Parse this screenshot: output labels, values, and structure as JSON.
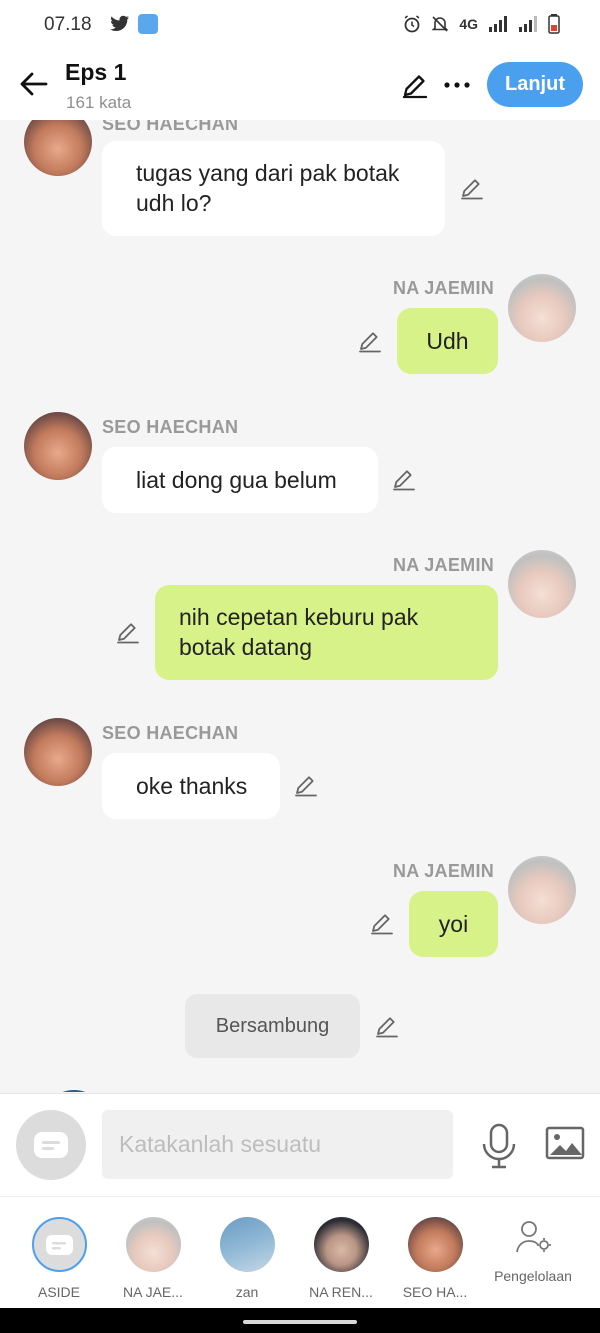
{
  "status_bar": {
    "time": "07.18",
    "network": "4G",
    "icons": [
      "twitter-icon",
      "novel-app-icon",
      "alarm-icon",
      "bell-off-icon",
      "signal-icon",
      "signal-icon",
      "battery-icon"
    ]
  },
  "header": {
    "title": "Eps 1",
    "subtitle": "161 kata",
    "next_label": "Lanjut",
    "icons": [
      "back-arrow-icon",
      "pencil-icon",
      "more-dots-icon"
    ]
  },
  "messages": [
    {
      "speaker": "SEO HAECHAN",
      "side": "left",
      "text_line1": "tugas yang dari pak botak",
      "text_line2": "udh lo?"
    },
    {
      "speaker": "NA JAEMIN",
      "side": "right",
      "text": "Udh"
    },
    {
      "speaker": "SEO HAECHAN",
      "side": "left",
      "text": "liat dong gua belum"
    },
    {
      "speaker": "NA JAEMIN",
      "side": "right",
      "text_line1": "nih cepetan keburu pak",
      "text_line2": "botak datang"
    },
    {
      "speaker": "SEO HAECHAN",
      "side": "left",
      "text": "oke thanks"
    },
    {
      "speaker": "NA JAEMIN",
      "side": "right",
      "text": "yoi"
    }
  ],
  "narration": "Bersambung",
  "input": {
    "placeholder": "Katakanlah sesuatu"
  },
  "characters": [
    {
      "label": "ASIDE"
    },
    {
      "label": "NA JAE..."
    },
    {
      "label": "zan"
    },
    {
      "label": "NA REN..."
    },
    {
      "label": "SEO HA..."
    },
    {
      "label": "Pengelolaan"
    }
  ],
  "colors": {
    "accent": "#4aa0ef",
    "right_bubble": "#d8f28a",
    "left_bubble": "#ffffff",
    "background": "#f5f5f5"
  }
}
